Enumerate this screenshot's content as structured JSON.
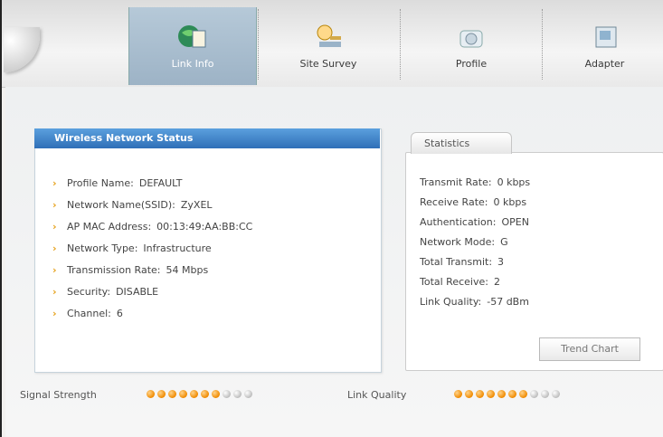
{
  "tabs": [
    {
      "label": "Link Info",
      "active": true,
      "icon": "globe-document-icon"
    },
    {
      "label": "Site Survey",
      "active": false,
      "icon": "search-network-icon"
    },
    {
      "label": "Profile",
      "active": false,
      "icon": "profile-camera-icon"
    },
    {
      "label": "Adapter",
      "active": false,
      "icon": "adapter-card-icon"
    }
  ],
  "wireless_status": {
    "title": "Wireless Network Status",
    "rows": [
      {
        "label": "Profile Name:",
        "value": "DEFAULT"
      },
      {
        "label": "Network Name(SSID):",
        "value": "ZyXEL"
      },
      {
        "label": "AP MAC Address:",
        "value": "00:13:49:AA:BB:CC"
      },
      {
        "label": "Network Type:",
        "value": "Infrastructure"
      },
      {
        "label": "Transmission Rate:",
        "value": "54 Mbps"
      },
      {
        "label": "Security:",
        "value": "DISABLE"
      },
      {
        "label": "Channel:",
        "value": "6"
      }
    ]
  },
  "statistics": {
    "tab_label": "Statistics",
    "rows": [
      {
        "label": "Transmit Rate:",
        "value": "0 kbps"
      },
      {
        "label": "Receive Rate:",
        "value": "0 kbps"
      },
      {
        "label": "Authentication:",
        "value": "OPEN"
      },
      {
        "label": "Network Mode:",
        "value": "G"
      },
      {
        "label": "Total Transmit:",
        "value": "3"
      },
      {
        "label": "Total Receive:",
        "value": "2"
      },
      {
        "label": "Link Quality:",
        "value": "-57 dBm"
      }
    ],
    "trend_button": "Trend Chart"
  },
  "bottom": {
    "signal_strength_label": "Signal Strength",
    "signal_strength_level": 7,
    "signal_strength_max": 10,
    "link_quality_label": "Link Quality",
    "link_quality_level": 7,
    "link_quality_max": 10
  },
  "colors": {
    "accent": "#2f6fb7",
    "dot_on": "#f08a00",
    "dot_off": "#bdbdbd",
    "chevron": "#e6a11a"
  }
}
